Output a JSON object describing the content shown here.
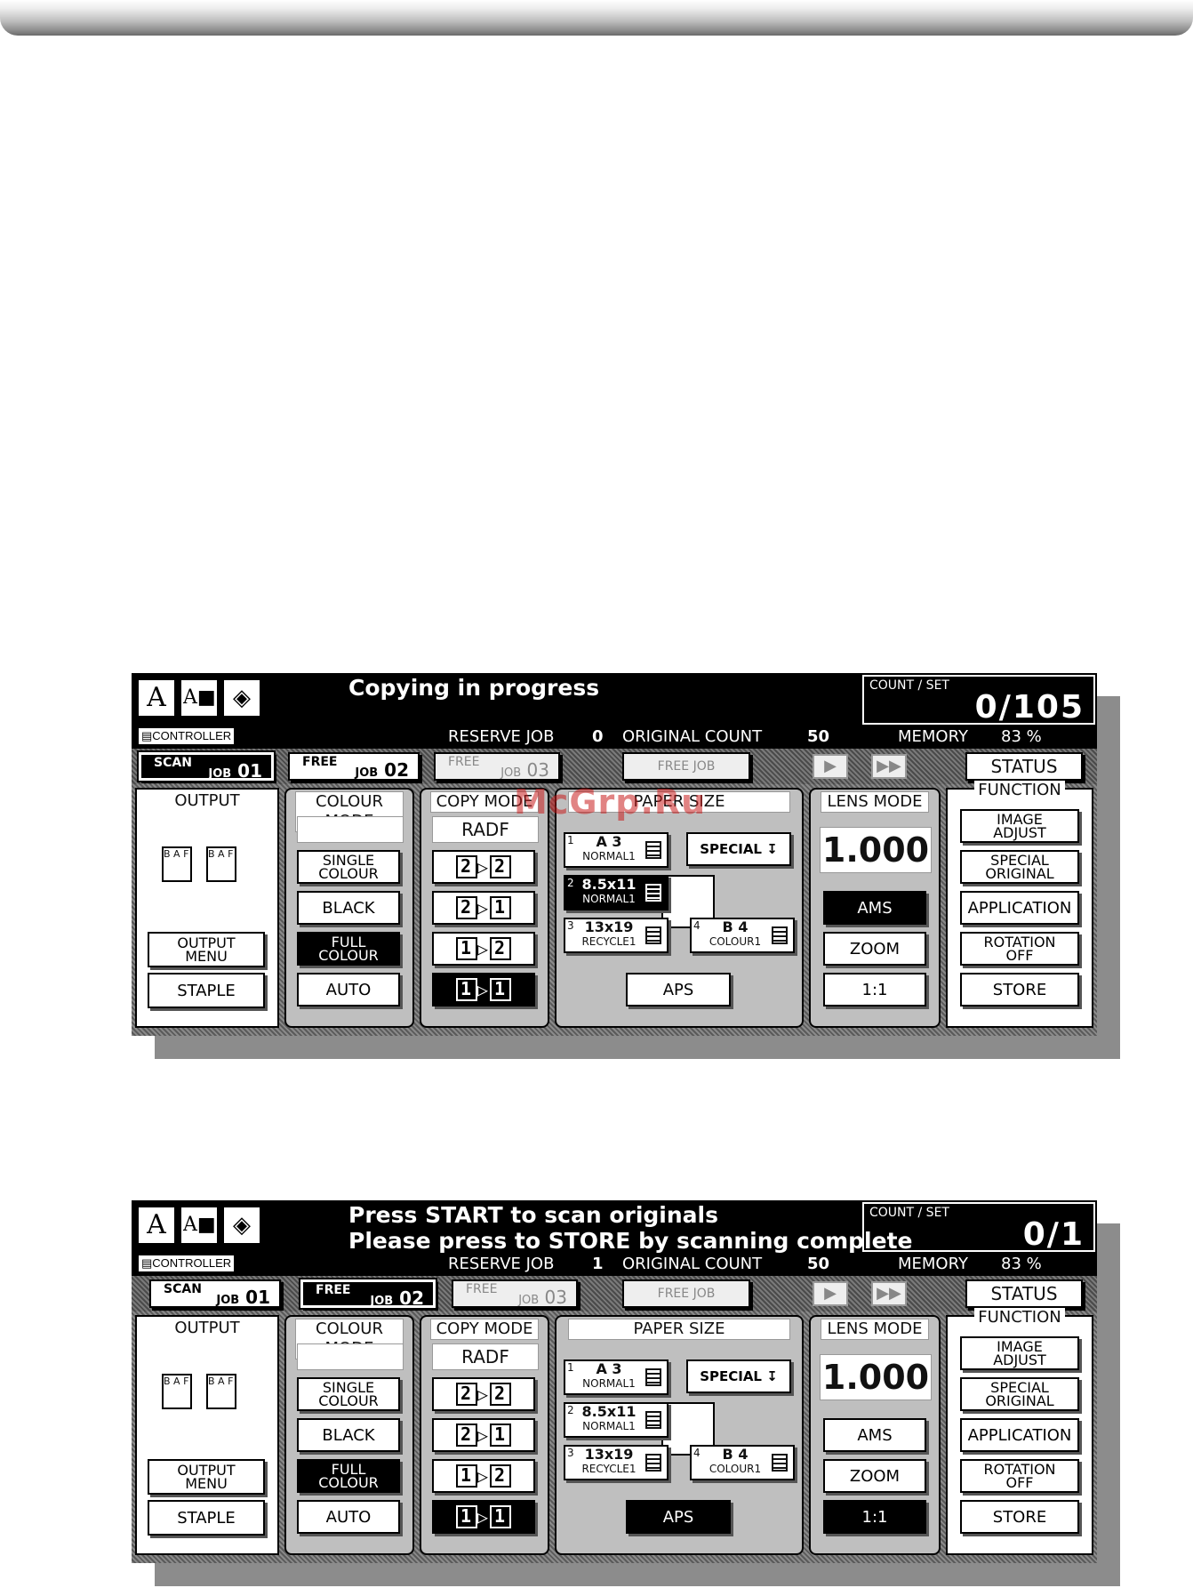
{
  "watermark": "McGrp.Ru",
  "screens": [
    {
      "message": [
        "Copying in progress",
        ""
      ],
      "count_label": "COUNT / SET",
      "count_value": "0/105",
      "controller": "CONTROLLER",
      "reserve_job_label": "RESERVE JOB",
      "reserve_job_value": "0",
      "original_count_label": "ORIGINAL COUNT",
      "original_count_value": "50",
      "memory_label": "MEMORY",
      "memory_value": "83 %",
      "tabs": {
        "tab1": {
          "label": "SCAN",
          "job": "JOB",
          "num": "01",
          "active": true
        },
        "tab2": {
          "label": "FREE",
          "job": "JOB",
          "num": "02",
          "active": false
        },
        "tab3": {
          "label": "FREE",
          "job": "JOB",
          "num": "03"
        },
        "tab4": {
          "label": "FREE JOB"
        }
      },
      "status_label": "STATUS",
      "output": {
        "title": "OUTPUT",
        "menu": [
          "OUTPUT",
          "MENU"
        ],
        "staple": "STAPLE"
      },
      "colour": {
        "title": "COLOUR MODE",
        "single": [
          "SINGLE",
          "COLOUR"
        ],
        "black": "BLACK",
        "full": [
          "FULL",
          "COLOUR"
        ],
        "auto": "AUTO"
      },
      "copy": {
        "title": "COPY MODE",
        "radf": "RADF"
      },
      "paper": {
        "title": "PAPER SIZE",
        "special": "SPECIAL",
        "aps": "APS",
        "trays": [
          {
            "num": "1",
            "size": "A 3",
            "type": "NORMAL1"
          },
          {
            "num": "2",
            "size": "8.5x11",
            "type": "NORMAL1"
          },
          {
            "num": "3",
            "size": "13x19",
            "type": "RECYCLE1"
          },
          {
            "num": "4",
            "size": "B 4",
            "type": "COLOUR1"
          }
        ]
      },
      "lens": {
        "title": "LENS MODE",
        "ratio": "1.000",
        "ams": "AMS",
        "zoom": "ZOOM",
        "one": "1:1"
      },
      "function": {
        "title": "FUNCTION",
        "image": [
          "IMAGE",
          "ADJUST"
        ],
        "special": [
          "SPECIAL",
          "ORIGINAL"
        ],
        "application": "APPLICATION",
        "rotation": [
          "ROTATION",
          "OFF"
        ],
        "store": "STORE"
      }
    },
    {
      "message": [
        "Press START to scan originals",
        "Please press to STORE by scanning complete"
      ],
      "count_label": "COUNT / SET",
      "count_value": "0/1",
      "controller": "CONTROLLER",
      "reserve_job_label": "RESERVE JOB",
      "reserve_job_value": "1",
      "original_count_label": "ORIGINAL COUNT",
      "original_count_value": "50",
      "memory_label": "MEMORY",
      "memory_value": "83 %",
      "tabs": {
        "tab1": {
          "label": "SCAN",
          "job": "JOB",
          "num": "01",
          "active": false
        },
        "tab2": {
          "label": "FREE",
          "job": "JOB",
          "num": "02",
          "active": true
        },
        "tab3": {
          "label": "FREE",
          "job": "JOB",
          "num": "03"
        },
        "tab4": {
          "label": "FREE JOB"
        }
      },
      "status_label": "STATUS",
      "output": {
        "title": "OUTPUT",
        "menu": [
          "OUTPUT",
          "MENU"
        ],
        "staple": "STAPLE"
      },
      "colour": {
        "title": "COLOUR MODE",
        "single": [
          "SINGLE",
          "COLOUR"
        ],
        "black": "BLACK",
        "full": [
          "FULL",
          "COLOUR"
        ],
        "auto": "AUTO"
      },
      "copy": {
        "title": "COPY MODE",
        "radf": "RADF"
      },
      "paper": {
        "title": "PAPER SIZE",
        "special": "SPECIAL",
        "aps": "APS",
        "trays": [
          {
            "num": "1",
            "size": "A 3",
            "type": "NORMAL1"
          },
          {
            "num": "2",
            "size": "8.5x11",
            "type": "NORMAL1"
          },
          {
            "num": "3",
            "size": "13x19",
            "type": "RECYCLE1"
          },
          {
            "num": "4",
            "size": "B 4",
            "type": "COLOUR1"
          }
        ]
      },
      "lens": {
        "title": "LENS MODE",
        "ratio": "1.000",
        "ams": "AMS",
        "zoom": "ZOOM",
        "one": "1:1"
      },
      "function": {
        "title": "FUNCTION",
        "image": [
          "IMAGE",
          "ADJUST"
        ],
        "special": [
          "SPECIAL",
          "ORIGINAL"
        ],
        "application": "APPLICATION",
        "rotation": [
          "ROTATION",
          "OFF"
        ],
        "store": "STORE"
      }
    }
  ]
}
